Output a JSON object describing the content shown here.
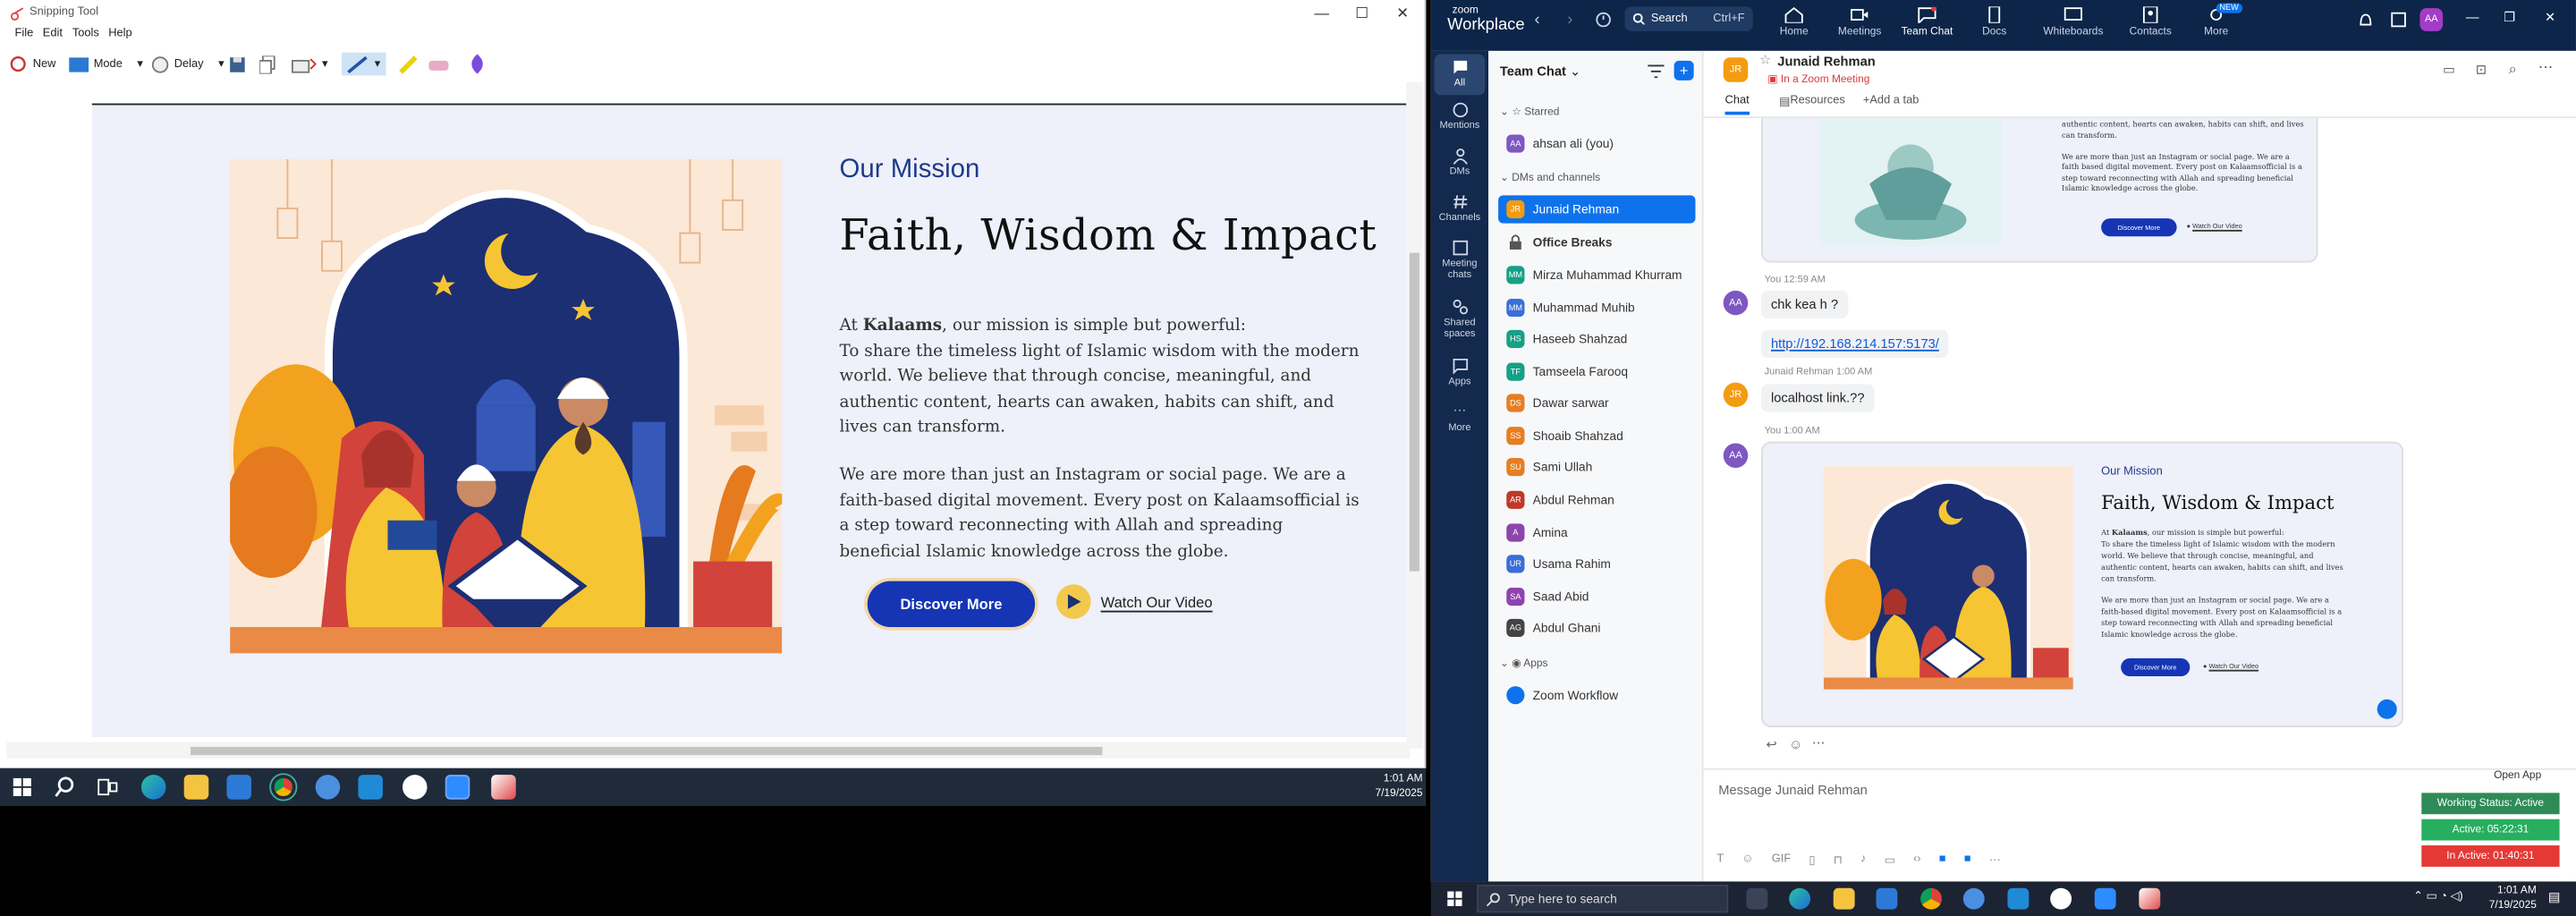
{
  "snip": {
    "title": "Snipping Tool",
    "menu": [
      "File",
      "Edit",
      "Tools",
      "Help"
    ],
    "toolbar": {
      "new": "New",
      "mode": "Mode",
      "delay": "Delay"
    }
  },
  "kalaams": {
    "eyebrow": "Our Mission",
    "heading": "Faith, Wisdom & Impact",
    "p1_lead": "At ",
    "p1_brand": "Kalaams",
    "p1_rest": ", our mission is simple but powerful:",
    "p1_body": "To share the timeless light of Islamic wisdom with the modern world. We believe that through concise, meaningful, and authentic content, hearts can awaken, habits can shift, and lives can transform.",
    "p2": "We are more than just an Instagram or social page. We are a faith-based digital movement. Every post on Kalaamsofficial is a step toward reconnecting with Allah and spreading beneficial Islamic knowledge across the globe.",
    "discover": "Discover More",
    "watch": "Watch Our Video"
  },
  "taskbar_left": {
    "time": "1:01 AM",
    "date": "7/19/2025"
  },
  "zoom": {
    "brand_small": "zoom",
    "brand": "Workplace",
    "search": "Search",
    "search_key": "Ctrl+F",
    "nav": [
      {
        "label": "Home"
      },
      {
        "label": "Meetings"
      },
      {
        "label": "Team Chat"
      },
      {
        "label": "Docs"
      },
      {
        "label": "Whiteboards"
      },
      {
        "label": "Contacts"
      },
      {
        "label": "More"
      }
    ],
    "new_badge": "NEW",
    "user_initials": "AA",
    "rail": [
      "All",
      "Mentions",
      "DMs",
      "Channels",
      "Meeting chats",
      "Shared spaces",
      "Apps",
      "More"
    ],
    "sidebar_title": "Team Chat",
    "starred": "Starred",
    "dms_channels": "DMs and channels",
    "apps_group": "Apps",
    "contacts": [
      {
        "name": "ahsan ali (you)",
        "init": "AA",
        "color": "#7e57c2"
      },
      {
        "name": "Junaid Rehman",
        "init": "JR",
        "color": "#f39c12"
      },
      {
        "name": "Office Breaks",
        "init": "",
        "color": "#555"
      },
      {
        "name": "Mirza Muhammad Khurram",
        "init": "MM",
        "color": "#16a085"
      },
      {
        "name": "Muhammad Muhib",
        "init": "MM",
        "color": "#3b6fd6"
      },
      {
        "name": "Haseeb Shahzad",
        "init": "HS",
        "color": "#16a085"
      },
      {
        "name": "Tamseela Farooq",
        "init": "TF",
        "color": "#16a085"
      },
      {
        "name": "Dawar sarwar",
        "init": "DS",
        "color": "#e67e22"
      },
      {
        "name": "Shoaib Shahzad",
        "init": "SS",
        "color": "#e67e22"
      },
      {
        "name": "Sami Ullah",
        "init": "SU",
        "color": "#e67e22"
      },
      {
        "name": "Abdul Rehman",
        "init": "AR",
        "color": "#c0392b"
      },
      {
        "name": "Amina",
        "init": "A",
        "color": "#8e44ad"
      },
      {
        "name": "Usama Rahim",
        "init": "UR",
        "color": "#3b6fd6"
      },
      {
        "name": "Saad Abid",
        "init": "SA",
        "color": "#8e44ad"
      },
      {
        "name": "Abdul Ghani",
        "init": "AG",
        "color": "#444"
      }
    ],
    "app_item": "Zoom Workflow",
    "chat_name": "Junaid Rehman",
    "chat_status": "In a Zoom Meeting",
    "tabs": [
      "Chat",
      "Resources",
      "Add a tab"
    ],
    "messages": [
      {
        "meta": "You 12:59 AM",
        "text": "chk kea h ?"
      },
      {
        "text": "http://192.168.214.157:5173/"
      },
      {
        "meta": "Junaid Rehman 1:00 AM",
        "text": "localhost link.??"
      },
      {
        "meta": "You 1:00 AM"
      }
    ],
    "open_app": "Open App",
    "composer_placeholder": "Message Junaid Rehman"
  },
  "work_status": [
    {
      "text": "Working Status: Active",
      "color": "#2e8b57"
    },
    {
      "text": "Active: 05:22:31",
      "color": "#27ae60"
    },
    {
      "text": "In Active: 01:40:31",
      "color": "#e53935"
    }
  ],
  "taskbar_right": {
    "search": "Type here to search",
    "time": "1:01 AM",
    "date": "7/19/2025"
  }
}
